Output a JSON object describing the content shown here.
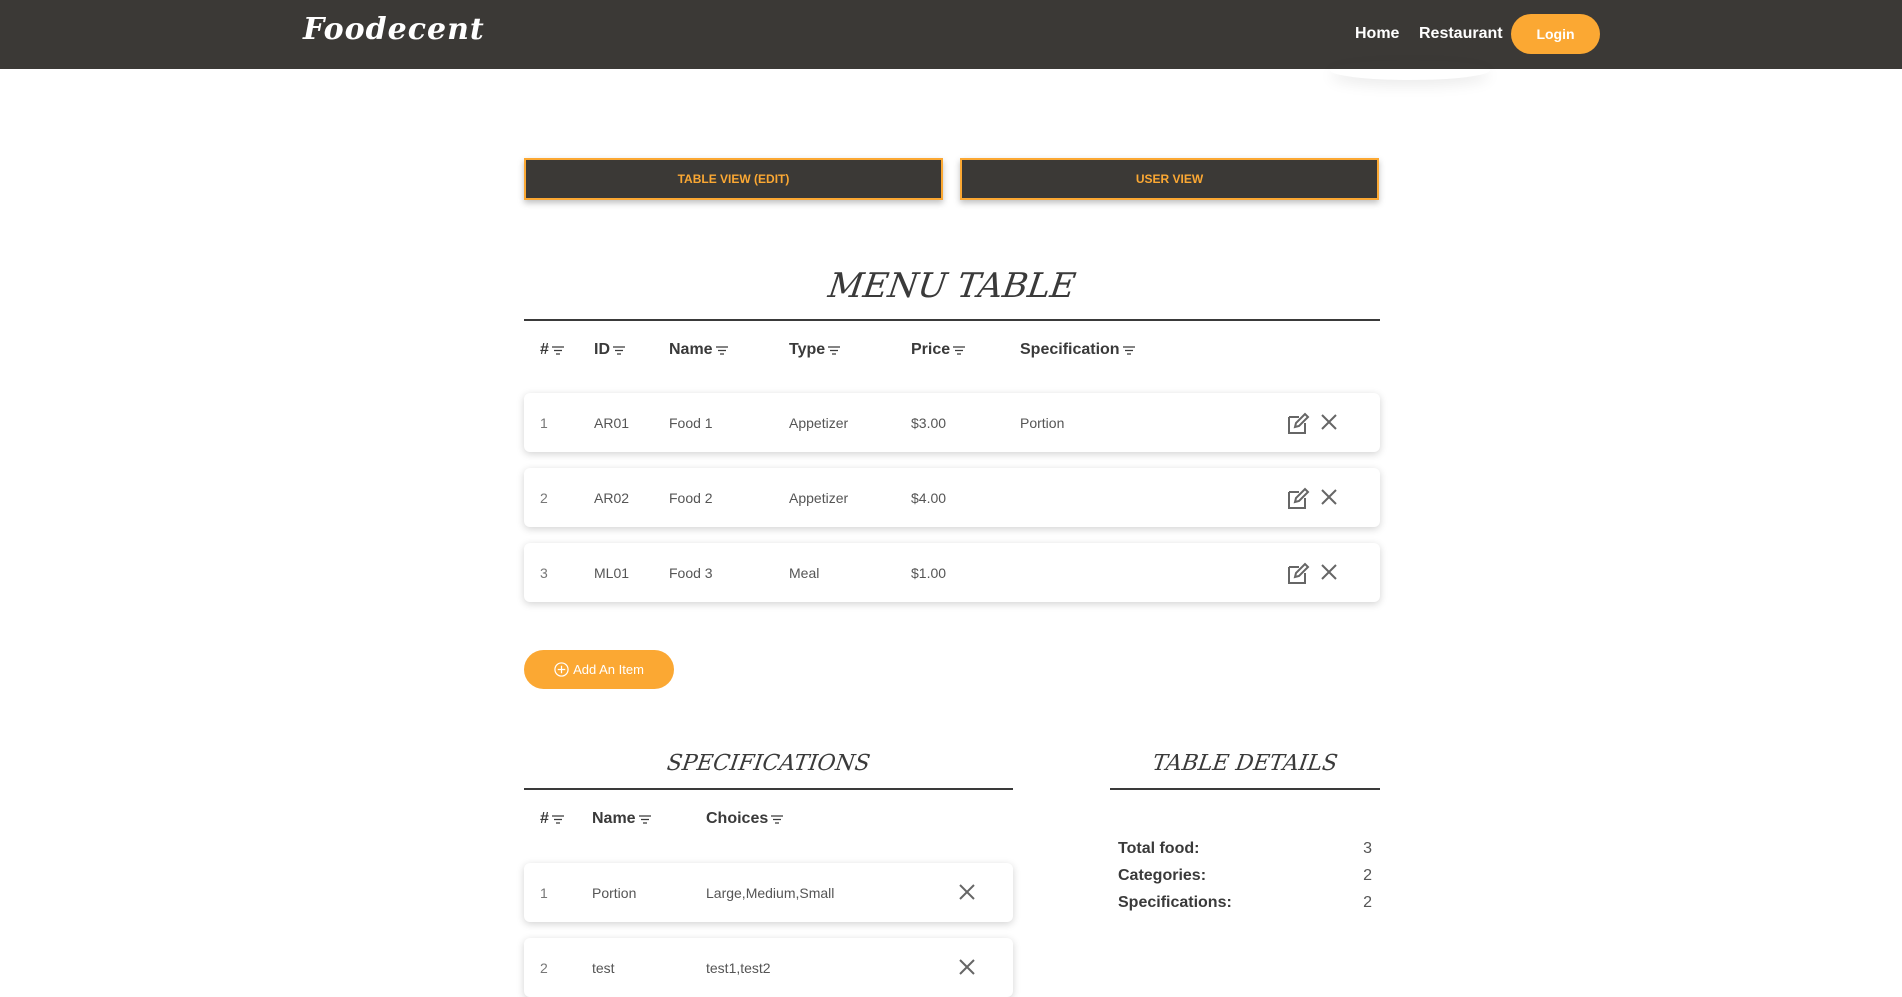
{
  "nav": {
    "brand": "Foodecent",
    "links": [
      "Home",
      "Restaurant"
    ],
    "login": "Login",
    "accent": "#fba833",
    "bg": "#3b3936"
  },
  "view_buttons": [
    "TABLE VIEW (EDIT)",
    "USER VIEW"
  ],
  "menu_table": {
    "title": "MENU TABLE",
    "headers": [
      "#",
      "ID",
      "Name",
      "Type",
      "Price",
      "Specification"
    ],
    "rows": [
      {
        "num": "1",
        "id": "AR01",
        "name": "Food 1",
        "type": "Appetizer",
        "price": "$3.00",
        "spec": "Portion"
      },
      {
        "num": "2",
        "id": "AR02",
        "name": "Food 2",
        "type": "Appetizer",
        "price": "$4.00",
        "spec": ""
      },
      {
        "num": "3",
        "id": "ML01",
        "name": "Food 3",
        "type": "Meal",
        "price": "$1.00",
        "spec": ""
      }
    ],
    "add_label": "Add An Item"
  },
  "specifications": {
    "title": "SPECIFICATIONS",
    "headers": [
      "#",
      "Name",
      "Choices"
    ],
    "rows": [
      {
        "num": "1",
        "name": "Portion",
        "choices": "Large,Medium,Small"
      },
      {
        "num": "2",
        "name": "test",
        "choices": "test1,test2"
      }
    ]
  },
  "table_details": {
    "title": "TABLE DETAILS",
    "items": [
      {
        "label": "Total food:",
        "value": "3"
      },
      {
        "label": "Categories:",
        "value": "2"
      },
      {
        "label": "Specifications:",
        "value": "2"
      }
    ]
  }
}
